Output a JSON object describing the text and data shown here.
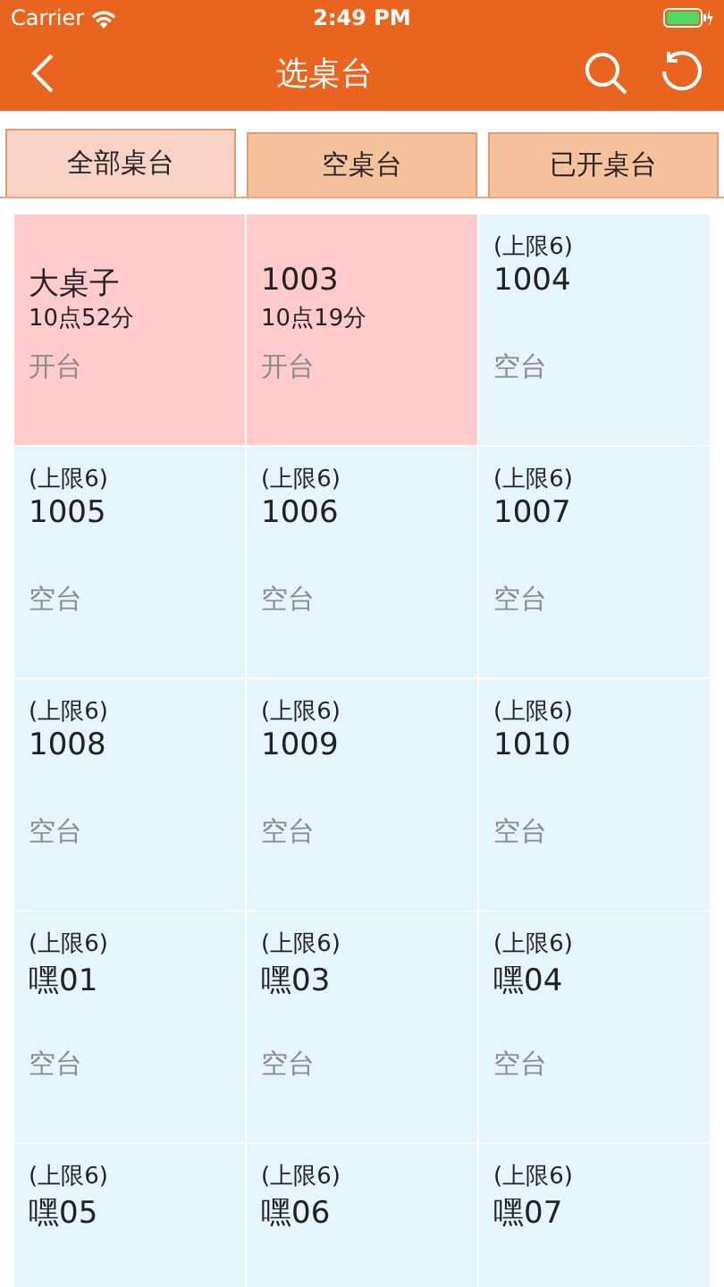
{
  "status_bar": {
    "carrier": "Carrier",
    "time": "2:49 PM"
  },
  "nav": {
    "title": "选桌台"
  },
  "tabs": [
    {
      "label": "全部桌台",
      "selected": true
    },
    {
      "label": "空桌台",
      "selected": false
    },
    {
      "label": "已开桌台",
      "selected": false
    }
  ],
  "rows": [
    {
      "tables": [
        {
          "kind": "open",
          "name": "大桌子",
          "time": "10点52分",
          "status": "开台"
        },
        {
          "kind": "open",
          "name": "1003",
          "time": "10点19分",
          "status": "开台"
        },
        {
          "kind": "empty",
          "limit": "(上限6)",
          "name": "1004",
          "status": "空台"
        }
      ]
    },
    {
      "tables": [
        {
          "kind": "empty",
          "limit": "(上限6)",
          "name": "1005",
          "status": "空台"
        },
        {
          "kind": "empty",
          "limit": "(上限6)",
          "name": "1006",
          "status": "空台"
        },
        {
          "kind": "empty",
          "limit": "(上限6)",
          "name": "1007",
          "status": "空台"
        }
      ]
    },
    {
      "tables": [
        {
          "kind": "empty",
          "limit": "(上限6)",
          "name": "1008",
          "status": "空台"
        },
        {
          "kind": "empty",
          "limit": "(上限6)",
          "name": "1009",
          "status": "空台"
        },
        {
          "kind": "empty",
          "limit": "(上限6)",
          "name": "1010",
          "status": "空台"
        }
      ]
    },
    {
      "tables": [
        {
          "kind": "empty",
          "limit": "(上限6)",
          "name": "嘿01",
          "status": "空台"
        },
        {
          "kind": "empty",
          "limit": "(上限6)",
          "name": "嘿03",
          "status": "空台"
        },
        {
          "kind": "empty",
          "limit": "(上限6)",
          "name": "嘿04",
          "status": "空台"
        }
      ]
    },
    {
      "tables": [
        {
          "kind": "empty",
          "limit": "(上限6)",
          "name": "嘿05"
        },
        {
          "kind": "empty",
          "limit": "(上限6)",
          "name": "嘿06"
        },
        {
          "kind": "empty",
          "limit": "(上限6)",
          "name": "嘿07"
        }
      ]
    }
  ]
}
